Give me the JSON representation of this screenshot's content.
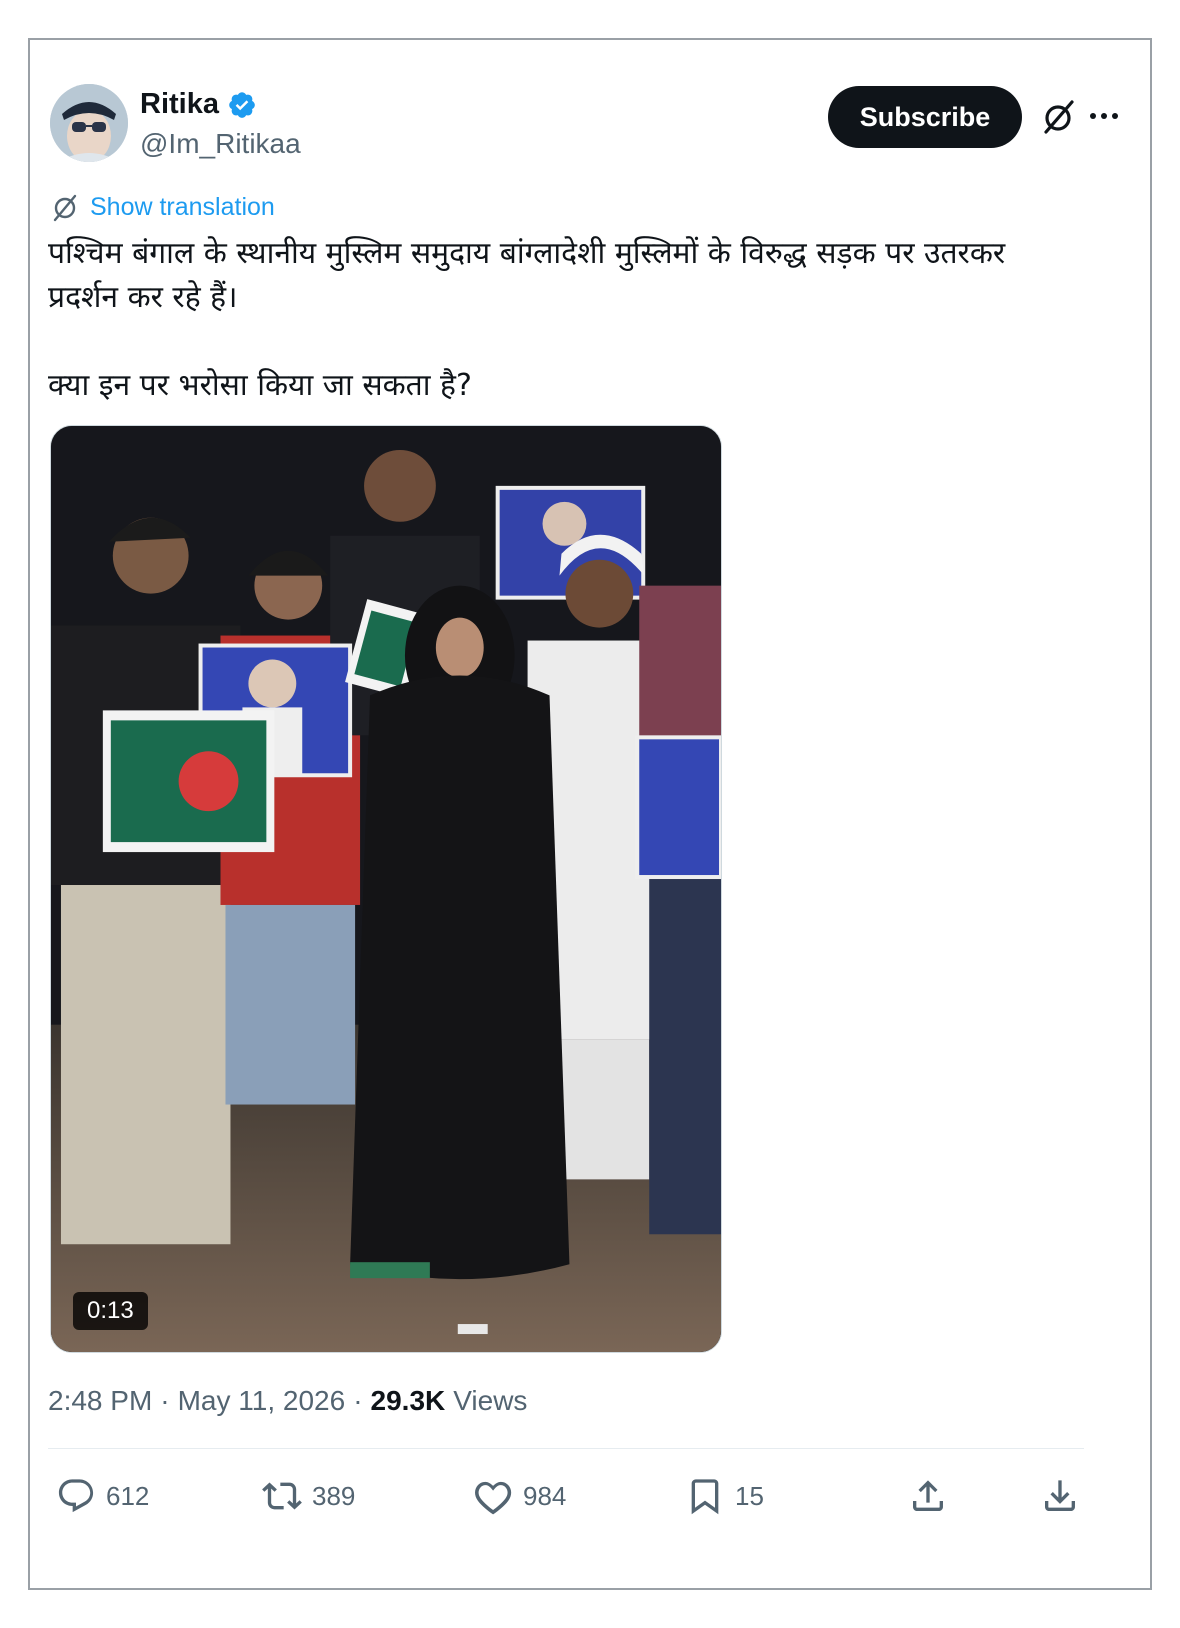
{
  "header": {
    "display_name": "Ritika",
    "handle": "@Im_Ritikaa",
    "subscribe_label": "Subscribe",
    "verified_color": "#1d9bf0"
  },
  "translation": {
    "label": "Show translation"
  },
  "tweet": {
    "text": "पश्चिम बंगाल के स्थानीय मुस्लिम समुदाय बांग्लादेशी मुस्लिमों के विरुद्ध सड़क पर उतरकर\nप्रदर्शन कर रहे हैं।\n\nक्या इन पर भरोसा किया जा सकता है?"
  },
  "media": {
    "duration": "0:13"
  },
  "meta": {
    "time": "2:48 PM",
    "separator1": "·",
    "date": "May 11, 2026",
    "separator2": "·",
    "views_count": "29.3K",
    "views_label": "Views"
  },
  "actions": {
    "replies": "612",
    "reposts": "389",
    "likes": "984",
    "bookmarks": "15"
  },
  "icons": {
    "reply": "reply-icon",
    "repost": "repost-icon",
    "like": "heart-icon",
    "bookmark": "bookmark-icon",
    "share": "share-icon",
    "download": "download-icon",
    "grok": "grok-icon",
    "more": "more-icon"
  },
  "colors": {
    "accent": "#1d9bf0",
    "text": "#0f1419",
    "secondary": "#536471"
  }
}
